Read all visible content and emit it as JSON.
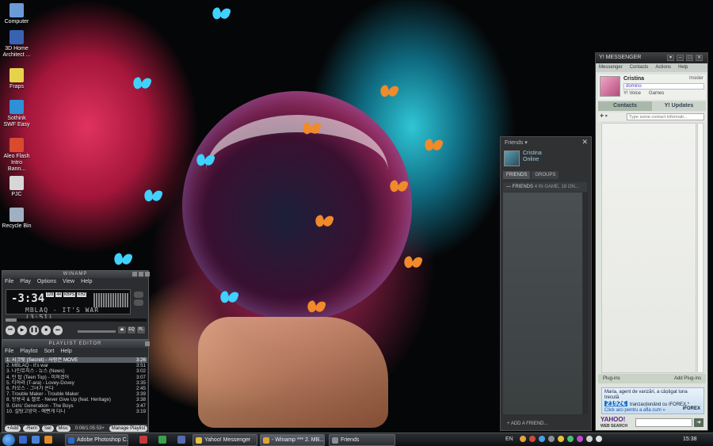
{
  "colors": {
    "accent_red": "#e0335f",
    "accent_cyan": "#2fc6d6",
    "steam_link": "#9fd0e8",
    "yahoo_purple": "#5b1a8c"
  },
  "desktop_icons": [
    {
      "label": "Computer",
      "icon": "computer-icon",
      "color": "#6a9bd8"
    },
    {
      "label": "3D Home Architect ...",
      "icon": "app-icon",
      "color": "#3a62b2"
    },
    {
      "label": "Fraps",
      "icon": "fraps-icon",
      "color": "#e6d34a"
    },
    {
      "label": "Sothink SWF Easy",
      "icon": "app-icon",
      "color": "#2f8fd8"
    },
    {
      "label": "Aleo Flash Intro Bann...",
      "icon": "app-icon",
      "color": "#d94a2f"
    },
    {
      "label": "PJC",
      "icon": "folder-icon",
      "color": "#d7d7d7"
    },
    {
      "label": "Recycle Bin",
      "icon": "recycle-bin-icon",
      "color": "#a0b0c0"
    }
  ],
  "winamp": {
    "title": "WINAMP",
    "menu": [
      "File",
      "Play",
      "Options",
      "View",
      "Help"
    ],
    "time": "-3:34",
    "badges": [
      "128",
      "44",
      "KBPS",
      "KHZ"
    ],
    "ticker": "MBLAQ - IT'S WAR (3:51)",
    "seek_progress": 0.08,
    "controls": [
      "⏮",
      "▶",
      "❚❚",
      "■",
      "⏭"
    ],
    "side_labels": [
      "EQ",
      "PL"
    ]
  },
  "playlist": {
    "title": "PLAYLIST EDITOR",
    "menu": [
      "File",
      "Playlist",
      "Sort",
      "Help"
    ],
    "tracks": [
      {
        "title": "1. 시크릿 (Secret) - 사랑은 MOVE",
        "time": "3:26",
        "selected": true
      },
      {
        "title": "2. MBLAQ - it's war",
        "time": "3:51",
        "selected": false
      },
      {
        "title": "3. 나인뮤지스 - 뉴스 (News)",
        "time": "3:02",
        "selected": false
      },
      {
        "title": "4. 틴 탑 (Teen Top) - 미쳐겠어",
        "time": "3:07",
        "selected": false
      },
      {
        "title": "5. 티아라 (T-ara) - Lovey-Dovey",
        "time": "3:35",
        "selected": false
      },
      {
        "title": "6. 카오스 - 그녀가 온다",
        "time": "2:45",
        "selected": false
      },
      {
        "title": "7. Trouble Maker - Trouble Maker",
        "time": "3:39",
        "selected": false
      },
      {
        "title": "8. 방용국 & 젤로 - Never Give Up (feat. Heritage)",
        "time": "3:38",
        "selected": false
      },
      {
        "title": "9. Girls' Generation - The Boys",
        "time": "3:47",
        "selected": false
      },
      {
        "title": "10. 설탕고양이 - 예뻔게 다니",
        "time": "3:19",
        "selected": false
      }
    ],
    "buttons": [
      "+Add",
      "-Rem",
      "Sel",
      "Misc"
    ],
    "total_time": "0:06/1:05:53+",
    "manage_label": "Manage Playlist"
  },
  "friends": {
    "title": "Friends",
    "user_name": "Cristina",
    "user_status": "Online",
    "tabs": [
      "FRIENDS",
      "GROUPS"
    ],
    "group_header": "FRIENDS",
    "group_counts": "4 IN GAME, 18 ON...",
    "add_friend": "ADD A FRIEND..."
  },
  "messenger": {
    "title": "MESSENGER",
    "menu": [
      "Messenger",
      "Contacts",
      "Actions",
      "Help"
    ],
    "user_name": "Cristina",
    "status_text": "domino",
    "insider": "Insider",
    "links": [
      "Y! Voice",
      "Games"
    ],
    "tabs": [
      "Contacts",
      "Y! Updates"
    ],
    "search_placeholder": "Type some contact informati...",
    "plugins_left": "Plug-ins",
    "plugins_right": "Add Plug-ins",
    "ad_line1": "Maria, agent de vanzări, a câștigat luna trecută",
    "ad_amount": "2192€",
    "ad_line2": "tranzacționând cu iFOREX.*",
    "ad_click": "Click aici pentru a afla cum »",
    "ad_brand": "iFOREX",
    "web_search_brand": "YAHOO!",
    "web_search_label": "WEB SEARCH"
  },
  "taskbar": {
    "tasks": [
      {
        "label": "Adobe Photoshop C...",
        "icon": "photoshop-icon",
        "color": "#2a6bc9",
        "active": false
      },
      {
        "label": "Yahoo! Messenger",
        "icon": "yahoo-icon",
        "color": "#e6c23a",
        "active": false
      },
      {
        "label": "- Winamp *** 2. MB...",
        "icon": "winamp-icon",
        "color": "#e0a23a",
        "active": true
      },
      {
        "label": "Friends",
        "icon": "steam-icon",
        "color": "#8a8f96",
        "active": false
      }
    ],
    "language": "EN",
    "clock": "15:38"
  }
}
